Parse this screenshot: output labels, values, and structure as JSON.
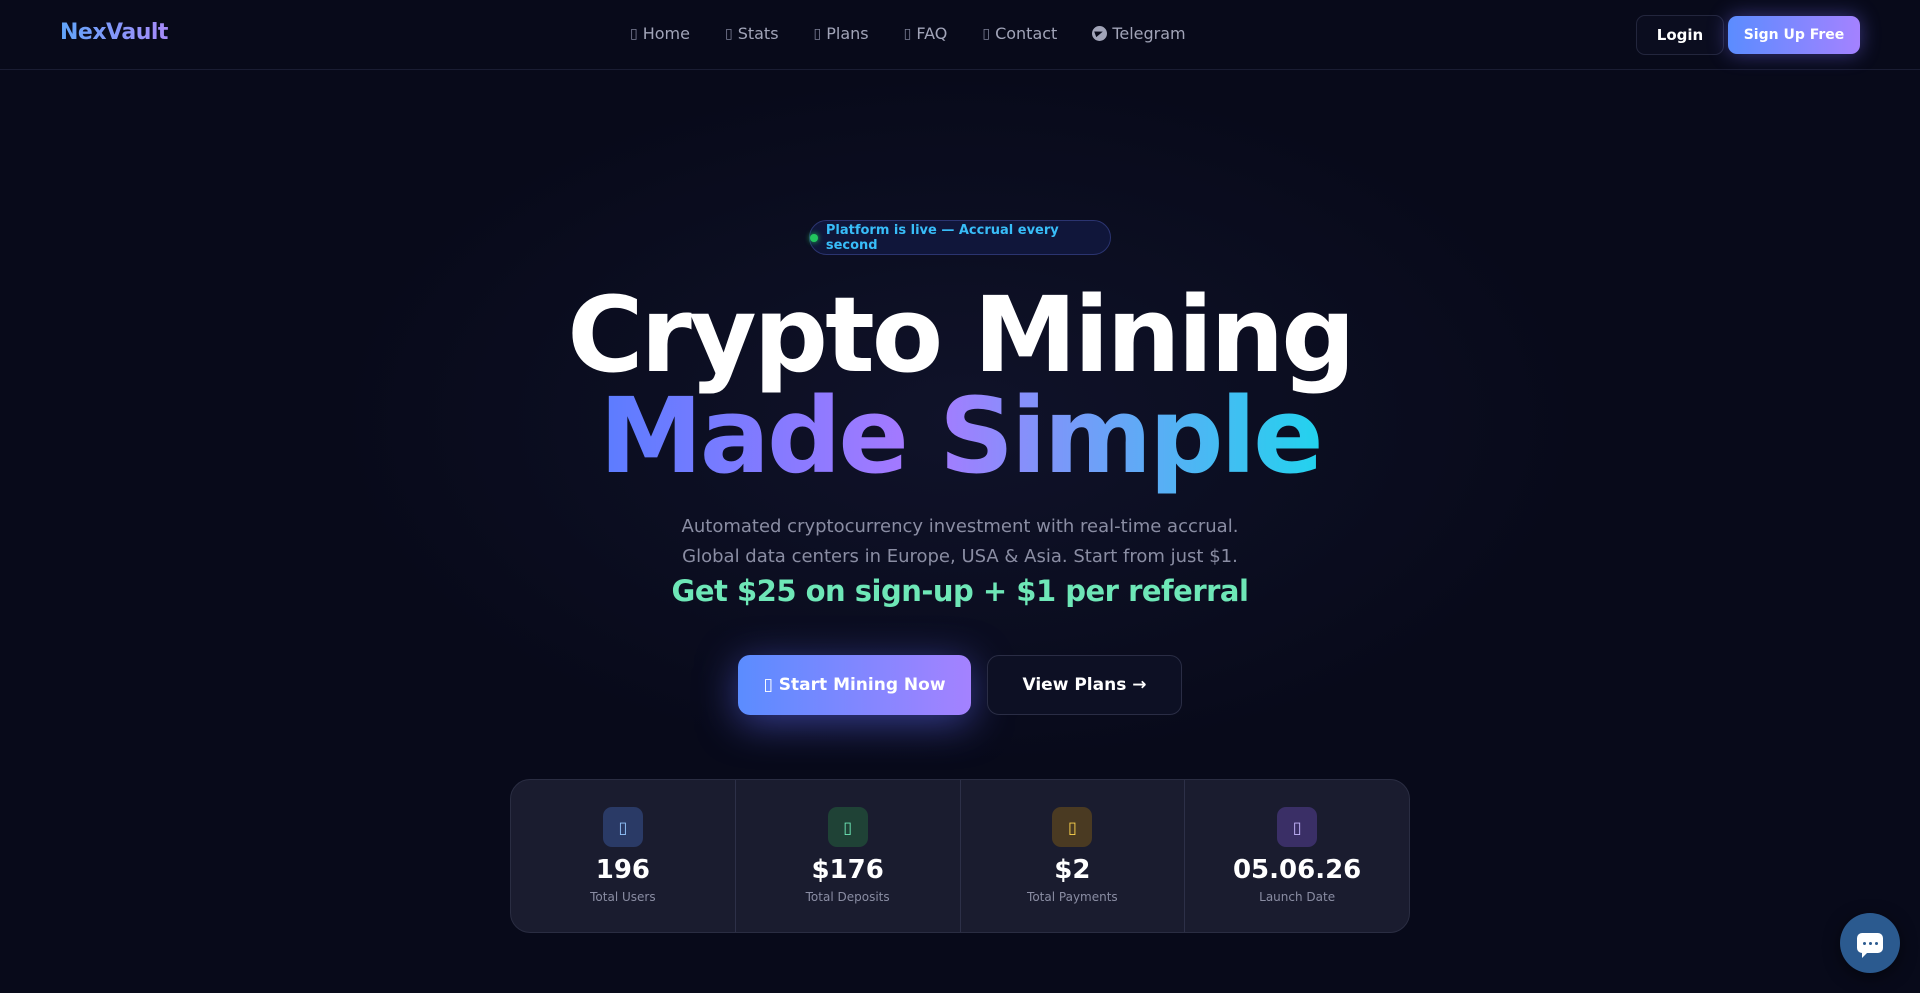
{
  "brand": {
    "name": "NexVault"
  },
  "nav": {
    "links": [
      {
        "label": "Home",
        "icon": "home-icon"
      },
      {
        "label": "Stats",
        "icon": "stats-icon"
      },
      {
        "label": "Plans",
        "icon": "plans-icon"
      },
      {
        "label": "FAQ",
        "icon": "faq-icon"
      },
      {
        "label": "Contact",
        "icon": "contact-icon"
      },
      {
        "label": "Telegram",
        "icon": "telegram-icon"
      }
    ],
    "login_label": "Login",
    "signup_label": "Sign Up Free"
  },
  "hero": {
    "badge": "Platform is live — Accrual every second",
    "title_line1": "Crypto Mining",
    "title_line2": "Made Simple",
    "subtitle_line1": "Automated cryptocurrency investment with real-time accrual.",
    "subtitle_line2": "Global data centers in Europe, USA & Asia. Start from just $1.",
    "bonus": "Get $25 on sign-up + $1 per referral",
    "primary_cta": "Start Mining Now",
    "secondary_cta": "View Plans →"
  },
  "stats": [
    {
      "value": "196",
      "label": "Total Users",
      "icon": "users-icon",
      "color": "#60a5fa"
    },
    {
      "value": "$176",
      "label": "Total Deposits",
      "icon": "deposits-icon",
      "color": "#34d399"
    },
    {
      "value": "$2",
      "label": "Total Payments",
      "icon": "payments-icon",
      "color": "#fbbf24"
    },
    {
      "value": "05.06.26",
      "label": "Launch Date",
      "icon": "calendar-icon",
      "color": "#a78bfa"
    }
  ],
  "colors": {
    "background": "#080a1a",
    "accent_start": "#5b8cff",
    "accent_end": "#a482ff",
    "bonus_green": "#6ee7b7",
    "badge_text": "#38bdf8"
  }
}
